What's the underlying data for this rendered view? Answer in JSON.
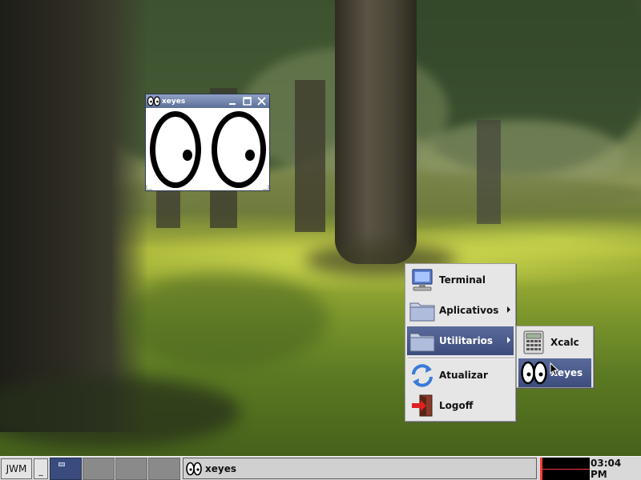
{
  "colors": {
    "titlebar": "#5c6f97",
    "menu_background": "#e6e6e6",
    "menu_highlight": "#3c4c7c",
    "taskbar_background": "#d9d9d9",
    "load_graph_line": "#ff3b3b"
  },
  "xeyes_window": {
    "title": "xeyes",
    "icon": "xeyes-icon",
    "buttons": [
      "minimize-icon",
      "maximize-icon",
      "close-icon"
    ]
  },
  "root_menu": {
    "items": [
      {
        "label": "Terminal",
        "icon": "terminal-icon",
        "submenu": false,
        "highlighted": false
      },
      {
        "label": "Aplicativos",
        "icon": "folder-icon",
        "submenu": true,
        "highlighted": false
      },
      {
        "label": "Utilitarios",
        "icon": "folder-icon",
        "submenu": true,
        "highlighted": true
      },
      {
        "label": "Atualizar",
        "icon": "refresh-icon",
        "submenu": false,
        "highlighted": false
      },
      {
        "label": "Logoff",
        "icon": "logoff-icon",
        "submenu": false,
        "highlighted": false
      }
    ]
  },
  "sub_menu": {
    "items": [
      {
        "label": "Xcalc",
        "icon": "calculator-icon",
        "highlighted": false
      },
      {
        "label": "Xeyes",
        "icon": "xeyes-icon",
        "highlighted": true
      }
    ]
  },
  "taskbar": {
    "menu_button_label": "JWM",
    "show_desktop_label": "_",
    "pager": {
      "desktops": 4,
      "active_desktop": 1
    },
    "tasks": [
      {
        "label": "xeyes",
        "icon": "xeyes-icon"
      }
    ],
    "clock": "03:04 PM"
  }
}
